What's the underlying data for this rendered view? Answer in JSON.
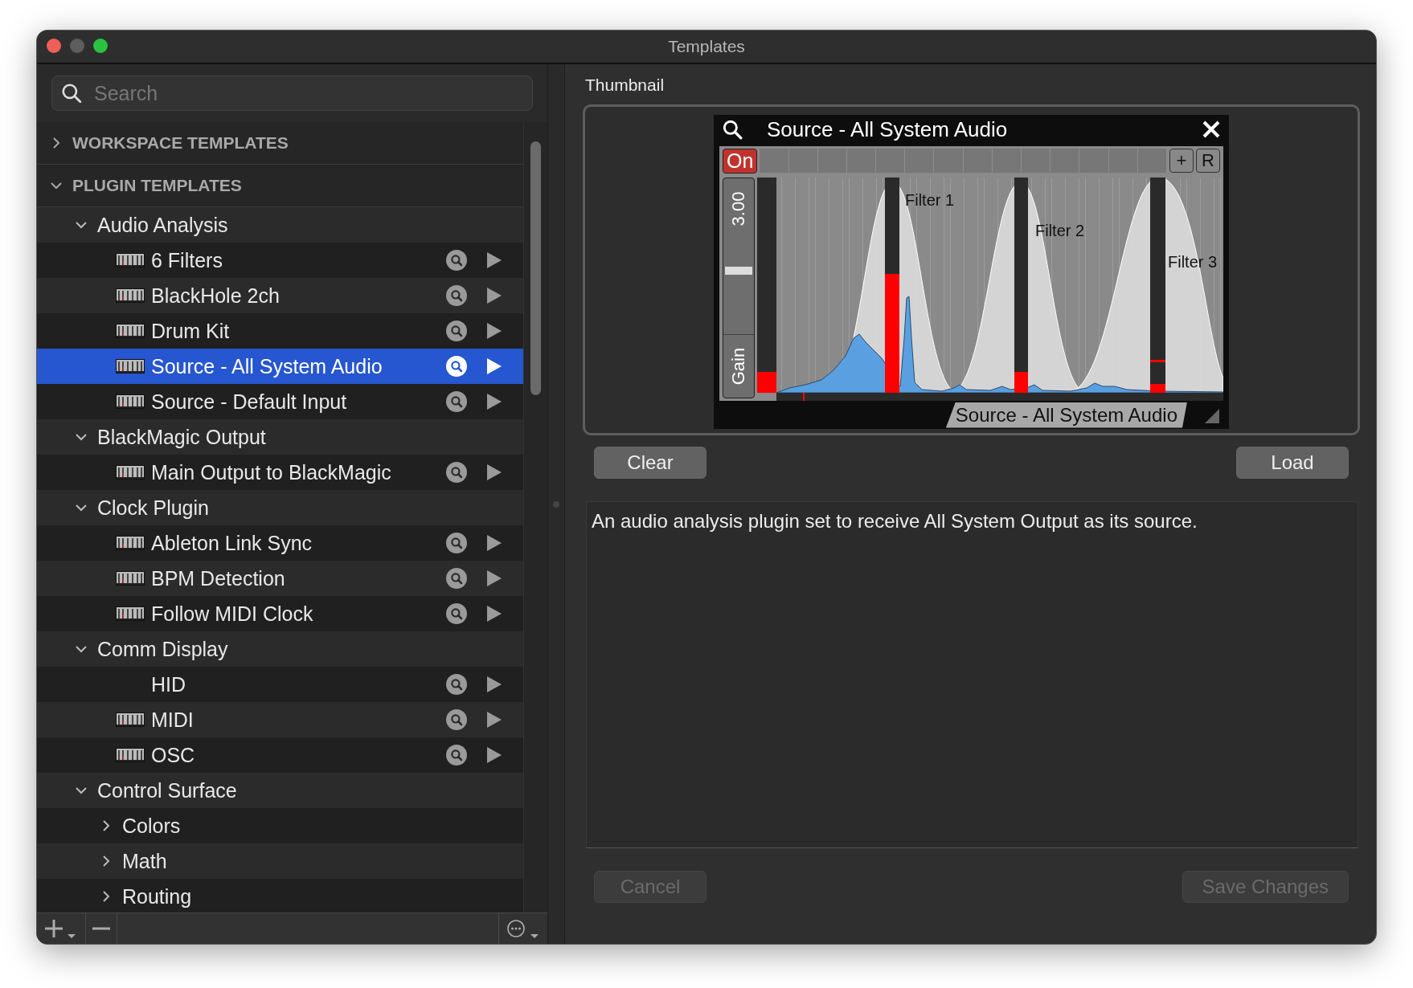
{
  "window": {
    "title": "Templates"
  },
  "search": {
    "placeholder": "Search"
  },
  "tree": [
    {
      "kind": "section",
      "label": "WORKSPACE TEMPLATES",
      "expanded": false
    },
    {
      "kind": "section",
      "label": "PLUGIN TEMPLATES",
      "expanded": true,
      "children": [
        {
          "kind": "folder",
          "label": "Audio Analysis",
          "expanded": true,
          "children": [
            {
              "kind": "template",
              "label": "6 Filters",
              "thumbnail": true,
              "selected": false
            },
            {
              "kind": "template",
              "label": "BlackHole 2ch",
              "thumbnail": true,
              "selected": false
            },
            {
              "kind": "template",
              "label": "Drum Kit",
              "thumbnail": true,
              "selected": false
            },
            {
              "kind": "template",
              "label": "Source - All System Audio",
              "thumbnail": true,
              "selected": true
            },
            {
              "kind": "template",
              "label": "Source - Default Input",
              "thumbnail": true,
              "selected": false
            }
          ]
        },
        {
          "kind": "folder",
          "label": "BlackMagic Output",
          "expanded": true,
          "children": [
            {
              "kind": "template",
              "label": "Main Output to BlackMagic",
              "thumbnail": true,
              "selected": false
            }
          ]
        },
        {
          "kind": "folder",
          "label": "Clock Plugin",
          "expanded": true,
          "children": [
            {
              "kind": "template",
              "label": "Ableton Link Sync",
              "thumbnail": true,
              "selected": false
            },
            {
              "kind": "template",
              "label": "BPM Detection",
              "thumbnail": true,
              "selected": false
            },
            {
              "kind": "template",
              "label": "Follow MIDI Clock",
              "thumbnail": true,
              "selected": false
            }
          ]
        },
        {
          "kind": "folder",
          "label": "Comm Display",
          "expanded": true,
          "children": [
            {
              "kind": "template",
              "label": "HID",
              "thumbnail": false,
              "selected": false
            },
            {
              "kind": "template",
              "label": "MIDI",
              "thumbnail": true,
              "selected": false
            },
            {
              "kind": "template",
              "label": "OSC",
              "thumbnail": true,
              "selected": false
            }
          ]
        },
        {
          "kind": "folder",
          "label": "Control Surface",
          "expanded": true,
          "children": [
            {
              "kind": "folder",
              "label": "Colors",
              "expanded": false
            },
            {
              "kind": "folder",
              "label": "Math",
              "expanded": false
            },
            {
              "kind": "folder",
              "label": "Routing",
              "expanded": false
            }
          ]
        }
      ]
    }
  ],
  "thumbnail": {
    "label": "Thumbnail",
    "plugin": {
      "title": "Source - All System Audio",
      "on_label": "On",
      "on": true,
      "add_label": "+",
      "reset_label": "R",
      "gain": {
        "value": "3.00",
        "label": "Gain",
        "level": 0.58
      },
      "filters": [
        "Filter 1",
        "Filter 2",
        "Filter 3"
      ],
      "footer": "Source - All System Audio"
    }
  },
  "actions": [
    {
      "label": "Clear",
      "disabled": false
    },
    {
      "label": "Load",
      "disabled": false
    }
  ],
  "description": "An audio analysis plugin set to receive All System Output as its source.",
  "footer_buttons": [
    {
      "label": "Cancel",
      "disabled": true
    },
    {
      "label": "Save Changes",
      "disabled": true
    }
  ]
}
